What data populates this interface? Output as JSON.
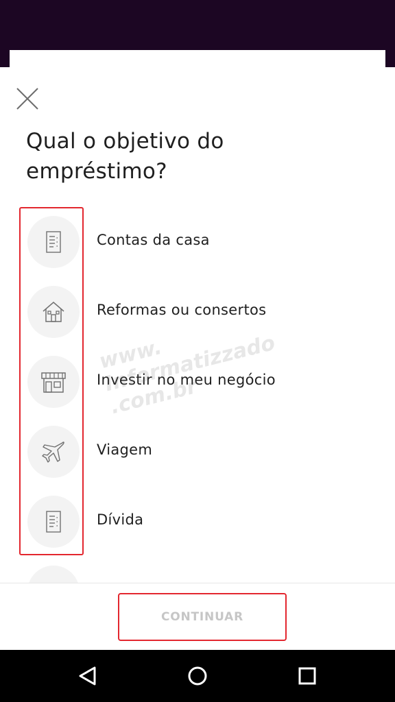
{
  "header": {
    "close_icon": "close-icon",
    "title": "Qual o objetivo do empréstimo?"
  },
  "options": [
    {
      "label": "Contas da casa",
      "icon": "bill-icon"
    },
    {
      "label": "Reformas ou consertos",
      "icon": "house-icon"
    },
    {
      "label": "Investir no meu negócio",
      "icon": "store-icon"
    },
    {
      "label": "Viagem",
      "icon": "airplane-icon"
    },
    {
      "label": "Dívida",
      "icon": "bill-icon"
    }
  ],
  "footer": {
    "continue_label": "CONTINUAR"
  },
  "watermark": {
    "lines": [
      "www.",
      "Informatizzado",
      ".com.br"
    ]
  },
  "navbar": {
    "back_icon": "back-icon",
    "home_icon": "home-icon",
    "recents_icon": "recents-icon"
  },
  "colors": {
    "status_bar": "#1c0623",
    "highlight": "#e3262e",
    "icon_circle": "#f3f3f3",
    "disabled_text": "#c6c6c6"
  }
}
